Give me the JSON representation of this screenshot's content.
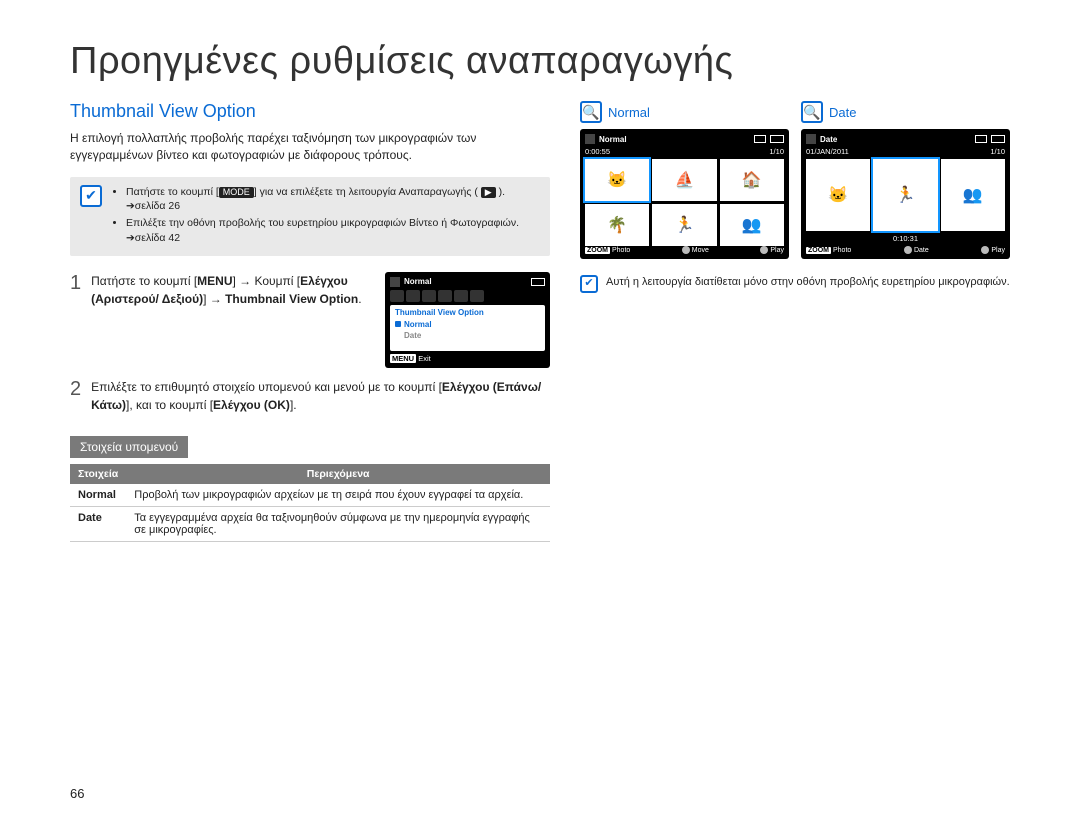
{
  "page_title": "Προηγμένες ρυθμίσεις αναπαραγωγής",
  "section_title": "Thumbnail View Option",
  "lead_paragraph": "Η επιλογή πολλαπλής προβολής παρέχει ταξινόμηση των μικρογραφιών των εγγεγραμμένων βίντεο και φωτογραφιών με διάφορους τρόπους.",
  "note_box": {
    "bullets": [
      {
        "prefix": "Πατήστε το κουμπί [",
        "badge": "MODE",
        "mid": "] για να επιλέξετε τη λειτουργία Αναπαραγωγής ( ",
        "icon": "▶",
        "suffix": " ). ➔σελίδα 26"
      },
      {
        "text": "Επιλέξτε την οθόνη προβολής του ευρετηρίου μικρογραφιών Βίντεο ή Φωτογραφιών. ➔σελίδα 42"
      }
    ]
  },
  "steps": [
    {
      "num": "1",
      "parts": [
        "Πατήστε το κουμπί [",
        "MENU",
        "] → Κουμπί [",
        "Ελέγχου (Αριστερού/ Δεξιού)",
        "] → ",
        "Thumbnail View Option",
        "."
      ]
    },
    {
      "num": "2",
      "text_plain": "Επιλέξτε το επιθυμητό στοιχείο υπομενού και μενού με το κουμπί [",
      "bold1": "Ελέγχου (Επάνω/Κάτω)",
      "mid": "], και το κουμπί [",
      "bold2": "Ελέγχου (OK)",
      "end": "]."
    }
  ],
  "menu_mini": {
    "top_label": "Normal",
    "panel_title": "Thumbnail View Option",
    "opt_selected": "Normal",
    "opt_other": "Date",
    "footer_tag": "MENU",
    "footer_text": "Exit"
  },
  "sub_heading": "Στοιχεία υπομενού",
  "table": {
    "headers": [
      "Στοιχεία",
      "Περιεχόμενα"
    ],
    "rows": [
      {
        "key": "Normal",
        "val": "Προβολή των μικρογραφιών αρχείων με τη σειρά που έχουν εγγραφεί τα αρχεία."
      },
      {
        "key": "Date",
        "val": "Τα εγγεγραμμένα αρχεία θα ταξινομηθούν σύμφωνα με την ημερομηνία εγγραφής σε μικρογραφίες."
      }
    ]
  },
  "devices": {
    "normal": {
      "label": "Normal",
      "top_label": "Normal",
      "time": "0:00:55",
      "counter": "1/10",
      "foot": {
        "zoom_tag": "ZOOM",
        "zoom": "Photo",
        "move": "Move",
        "play": "Play"
      }
    },
    "date": {
      "label": "Date",
      "top_label": "Date",
      "date_text": "01/JAN/2011",
      "counter": "1/10",
      "caption": "0:10:31",
      "foot": {
        "zoom_tag": "ZOOM",
        "zoom": "Photo",
        "date": "Date",
        "play": "Play"
      }
    }
  },
  "right_note": "Αυτή η λειτουργία διατίθεται μόνο στην οθόνη προβολής ευρετηρίου μικρογραφιών.",
  "page_number": "66"
}
